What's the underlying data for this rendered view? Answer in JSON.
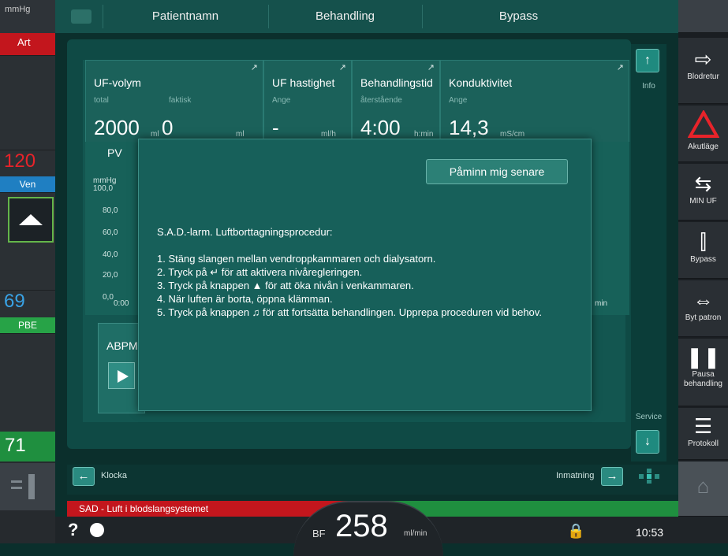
{
  "left": {
    "unit": "mmHg",
    "art_label": "Art",
    "ven_value": "120",
    "ven_label": "Ven",
    "pbe_value": "69",
    "pbe_label": "PBE",
    "tmp_value": "71"
  },
  "topbar": {
    "patient": "Patientnamn",
    "treatment": "Behandling",
    "bypass": "Bypass"
  },
  "params": [
    {
      "title": "UF-volym",
      "sub1": "total",
      "sub2": "faktisk",
      "value1": "2000",
      "unit1": "ml",
      "value2": "0",
      "unit2": "ml"
    },
    {
      "title": "UF hastighet",
      "sub": "Ange",
      "value": "-",
      "unit": "ml/h"
    },
    {
      "title": "Behandlingstid",
      "sub": "återstående",
      "value": "4:00",
      "unit": "h:min"
    },
    {
      "title": "Konduktivitet",
      "sub": "Ange",
      "value": "14,3",
      "unit": "mS/cm"
    }
  ],
  "chart": {
    "title": "PV",
    "yunit": "mmHg",
    "yticks": [
      "100,0",
      "80,0",
      "60,0",
      "40,0",
      "20,0",
      "0,0"
    ],
    "xstart": "0:00",
    "xunit": "min"
  },
  "abpm_label": "ABPM",
  "dialog": {
    "remind_label": "Påminn mig senare",
    "heading": "S.A.D.-larm. Luftborttagningsprocedur:",
    "steps": [
      "1. Stäng slangen mellan vendroppkammaren och dialysatorn.",
      "2. Tryck på ↵ för att aktivera nivåregleringen.",
      "3. Tryck på knappen ▲ för att öka nivån i venkammaren.",
      "4. När luften är borta, öppna klämman.",
      "5. Tryck på knappen ♫ för att fortsätta behandlingen. Upprepa proceduren vid behov."
    ]
  },
  "scroll": {
    "info_label": "Info",
    "service_label": "Service"
  },
  "rightbar": {
    "blodretur": "Blodretur",
    "akutlage": "Akutläge",
    "minuf": "MIN UF",
    "bypass": "Bypass",
    "bytpatron": "Byt patron",
    "pausa": "Pausa behandling",
    "protokoll": "Protokoll"
  },
  "bottomnav": {
    "klocka": "Klocka",
    "inmatning": "Inmatning"
  },
  "alarm_text": "SAD - Luft i blodslangsystemet",
  "status": {
    "bf_label": "BF",
    "bf_value": "258",
    "bf_unit": "ml/min",
    "time": "10:53",
    "help": "?"
  },
  "colors": {
    "alarm_red": "#c3161d",
    "ok_green": "#1f8f3f",
    "ven_blue": "#1f7fc2",
    "teal": "#135650"
  }
}
